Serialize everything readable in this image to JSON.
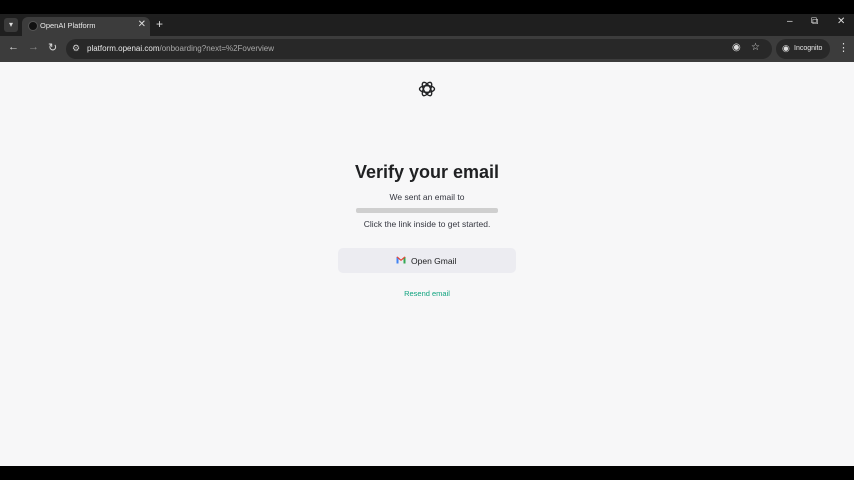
{
  "browser": {
    "tab_title": "OpenAI Platform",
    "url_host": "platform.openai.com",
    "url_path": "/onboarding?next=%2Foverview",
    "incognito_label": "Incognito"
  },
  "page": {
    "heading": "Verify your email",
    "sent_text": "We sent an email to",
    "instructions": "Click the link inside to get started.",
    "open_gmail_label": "Open Gmail",
    "resend_label": "Resend email"
  },
  "colors": {
    "accent": "#10a37f",
    "button_bg": "#ececf1",
    "page_bg": "#f7f7f8"
  }
}
